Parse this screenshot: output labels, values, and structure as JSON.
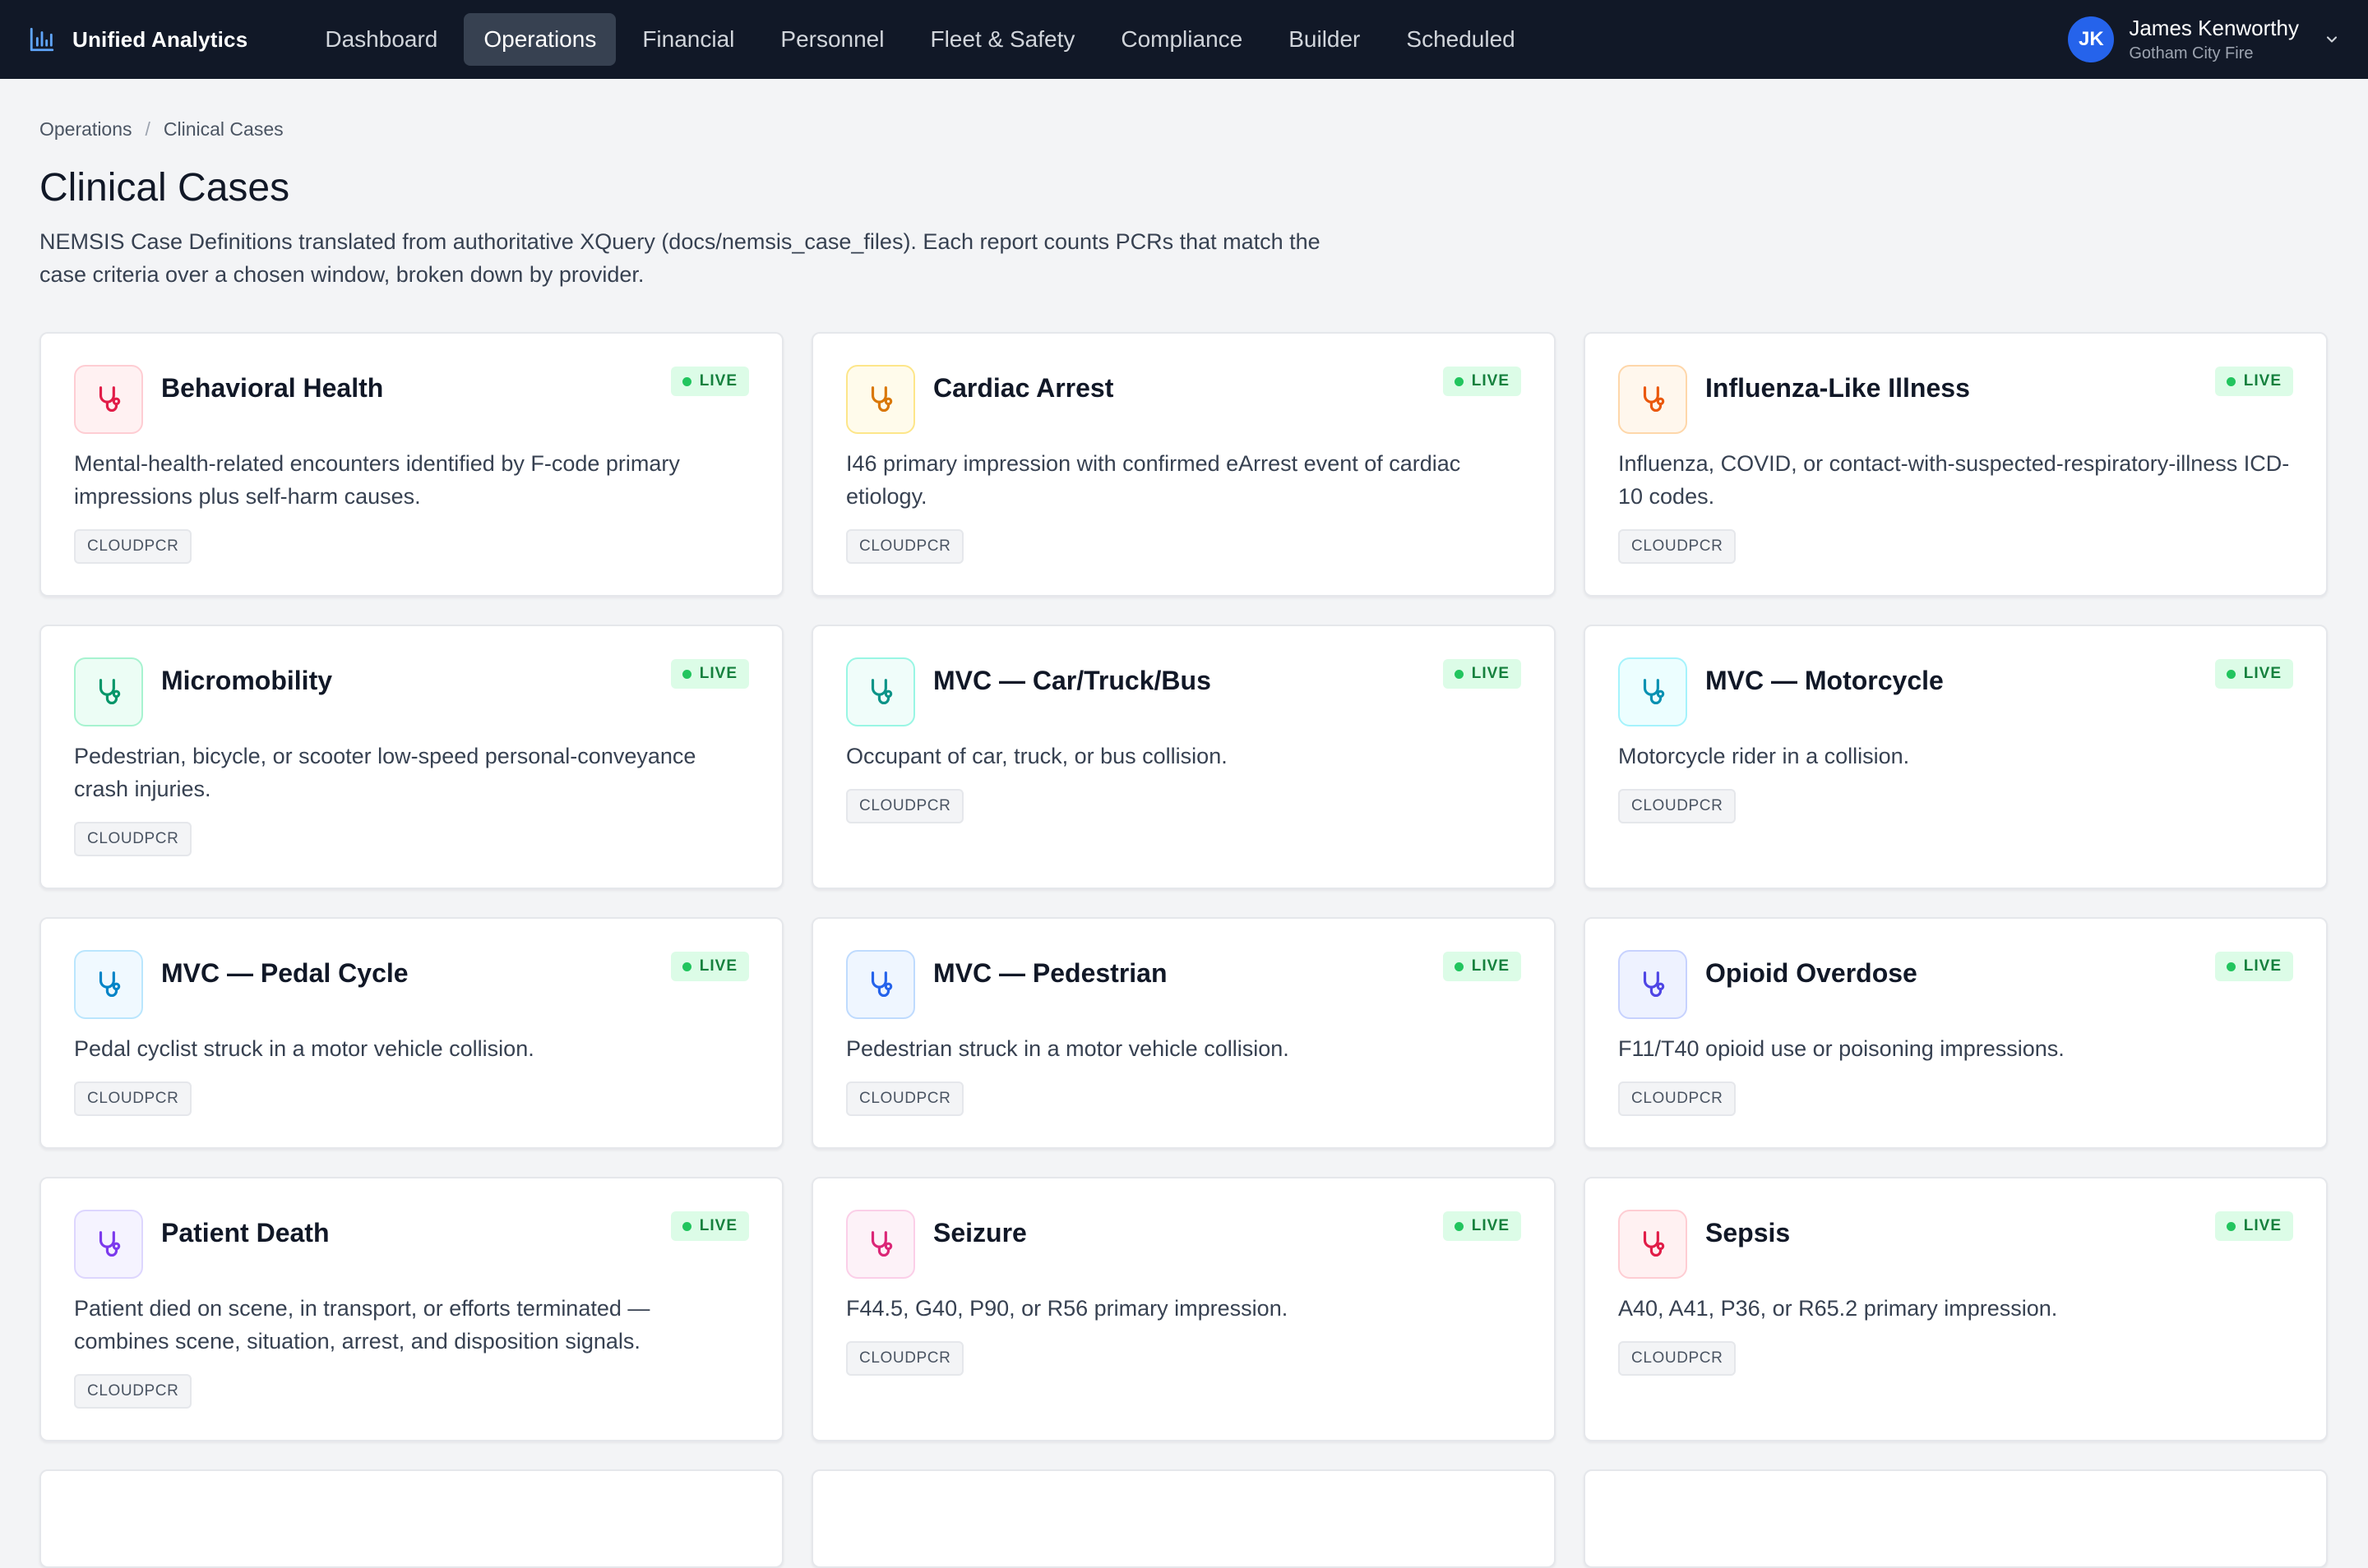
{
  "app": {
    "name": "Unified Analytics"
  },
  "nav": [
    {
      "label": "Dashboard",
      "active": false
    },
    {
      "label": "Operations",
      "active": true
    },
    {
      "label": "Financial",
      "active": false
    },
    {
      "label": "Personnel",
      "active": false
    },
    {
      "label": "Fleet & Safety",
      "active": false
    },
    {
      "label": "Compliance",
      "active": false
    },
    {
      "label": "Builder",
      "active": false
    },
    {
      "label": "Scheduled",
      "active": false
    }
  ],
  "user": {
    "initials": "JK",
    "name": "James Kenworthy",
    "org": "Gotham City Fire"
  },
  "breadcrumb": {
    "parent": "Operations",
    "separator": "/",
    "current": "Clinical Cases"
  },
  "page": {
    "title": "Clinical Cases",
    "description": "NEMSIS Case Definitions translated from authoritative XQuery (docs/nemsis_case_files). Each report counts PCRs that match the case criteria over a chosen window, broken down by provider."
  },
  "badge": {
    "label": "LIVE"
  },
  "tag": {
    "label": "CLOUDPCR"
  },
  "icons": {
    "case": "stethoscope-icon",
    "brand": "bar-chart-icon",
    "user_menu": "chevron-down-icon"
  },
  "cards": [
    {
      "title": "Behavioral Health",
      "description": "Mental-health-related encounters identified by F-code primary impressions plus self-harm causes.",
      "color": "#e11d48",
      "tile_bg": "#fff1f2",
      "tile_border": "#fecdd3"
    },
    {
      "title": "Cardiac Arrest",
      "description": "I46 primary impression with confirmed eArrest event of cardiac etiology.",
      "color": "#d97706",
      "tile_bg": "#fffbeb",
      "tile_border": "#fde68a"
    },
    {
      "title": "Influenza-Like Illness",
      "description": "Influenza, COVID, or contact-with-suspected-respiratory-illness ICD-10 codes.",
      "color": "#ea580c",
      "tile_bg": "#fff7ed",
      "tile_border": "#fed7aa"
    },
    {
      "title": "Micromobility",
      "description": "Pedestrian, bicycle, or scooter low-speed personal-conveyance crash injuries.",
      "color": "#059669",
      "tile_bg": "#ecfdf5",
      "tile_border": "#a7f3d0"
    },
    {
      "title": "MVC — Car/Truck/Bus",
      "description": "Occupant of car, truck, or bus collision.",
      "color": "#0d9488",
      "tile_bg": "#f0fdfa",
      "tile_border": "#99f6e4"
    },
    {
      "title": "MVC — Motorcycle",
      "description": "Motorcycle rider in a collision.",
      "color": "#0891b2",
      "tile_bg": "#ecfeff",
      "tile_border": "#a5f3fc"
    },
    {
      "title": "MVC — Pedal Cycle",
      "description": "Pedal cyclist struck in a motor vehicle collision.",
      "color": "#0284c7",
      "tile_bg": "#f0f9ff",
      "tile_border": "#bae6fd"
    },
    {
      "title": "MVC — Pedestrian",
      "description": "Pedestrian struck in a motor vehicle collision.",
      "color": "#2563eb",
      "tile_bg": "#eff6ff",
      "tile_border": "#bfdbfe"
    },
    {
      "title": "Opioid Overdose",
      "description": "F11/T40 opioid use or poisoning impressions.",
      "color": "#4f46e5",
      "tile_bg": "#eef2ff",
      "tile_border": "#c7d2fe"
    },
    {
      "title": "Patient Death",
      "description": "Patient died on scene, in transport, or efforts terminated — combines scene, situation, arrest, and disposition signals.",
      "color": "#7c3aed",
      "tile_bg": "#f5f3ff",
      "tile_border": "#ddd6fe"
    },
    {
      "title": "Seizure",
      "description": "F44.5, G40, P90, or R56 primary impression.",
      "color": "#db2777",
      "tile_bg": "#fdf2f8",
      "tile_border": "#fbcfe8"
    },
    {
      "title": "Sepsis",
      "description": "A40, A41, P36, or R65.2 primary impression.",
      "color": "#e11d48",
      "tile_bg": "#fff1f2",
      "tile_border": "#fecdd3"
    }
  ]
}
